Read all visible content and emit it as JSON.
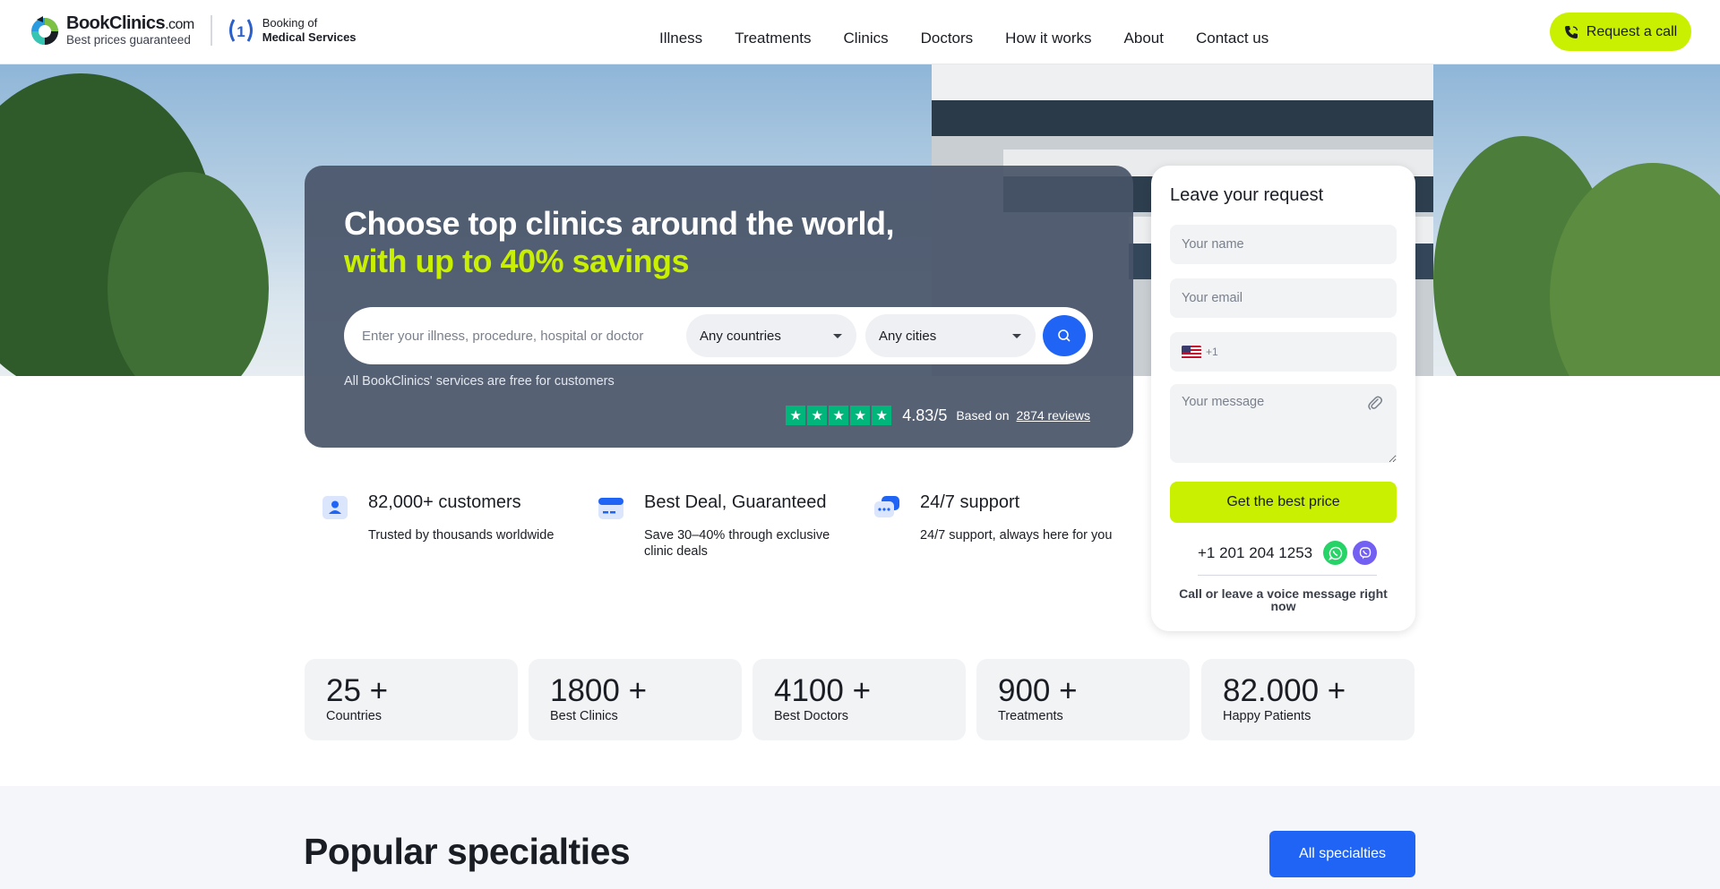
{
  "header": {
    "logo": {
      "name": "BookClinics",
      "domain": ".com",
      "tagline": "Best prices guaranteed"
    },
    "award": {
      "line1": "Booking of",
      "line2": "Medical Services",
      "rank": "1"
    },
    "nav": [
      "Illness",
      "Treatments",
      "Clinics",
      "Doctors",
      "How it works",
      "About",
      "Contact us"
    ],
    "call_label": "Request a call"
  },
  "hero": {
    "title_line1": "Choose top clinics around the world,",
    "title_line2": "with up to 40% savings",
    "search_placeholder": "Enter your illness, procedure, hospital or doctor",
    "country_select": "Any countries",
    "city_select": "Any cities",
    "free_note": "All BookClinics' services are free for customers",
    "rating": {
      "stars": 5,
      "value": "4.83/5",
      "based_on": "Based on",
      "reviews": "2874 reviews"
    }
  },
  "form": {
    "title": "Leave your request",
    "name_placeholder": "Your name",
    "email_placeholder": "Your email",
    "phone_code": "+1",
    "message_placeholder": "Your message",
    "submit_label": "Get the best price",
    "phone": "+1 201 204 1253",
    "note": "Call or leave a voice message right now"
  },
  "features": [
    {
      "title": "82,000+ customers",
      "desc": "Trusted by thousands worldwide",
      "icon": "user-icon"
    },
    {
      "title": "Best Deal, Guaranteed",
      "desc": "Save 30–40% through exclusive clinic deals",
      "icon": "card-icon"
    },
    {
      "title": "24/7 support",
      "desc": "24/7 support, always here for you",
      "icon": "chat-icon"
    }
  ],
  "stats": [
    {
      "value": "25 +",
      "label": "Countries"
    },
    {
      "value": "1800 +",
      "label": "Best Clinics"
    },
    {
      "value": "4100 +",
      "label": "Best Doctors"
    },
    {
      "value": "900 +",
      "label": "Treatments"
    },
    {
      "value": "82.000 +",
      "label": "Happy Patients"
    }
  ],
  "popular": {
    "title": "Popular specialties",
    "button": "All specialties"
  },
  "colors": {
    "accent": "#c8f000",
    "primary": "#1f64f5",
    "trustpilot": "#00b67a"
  }
}
